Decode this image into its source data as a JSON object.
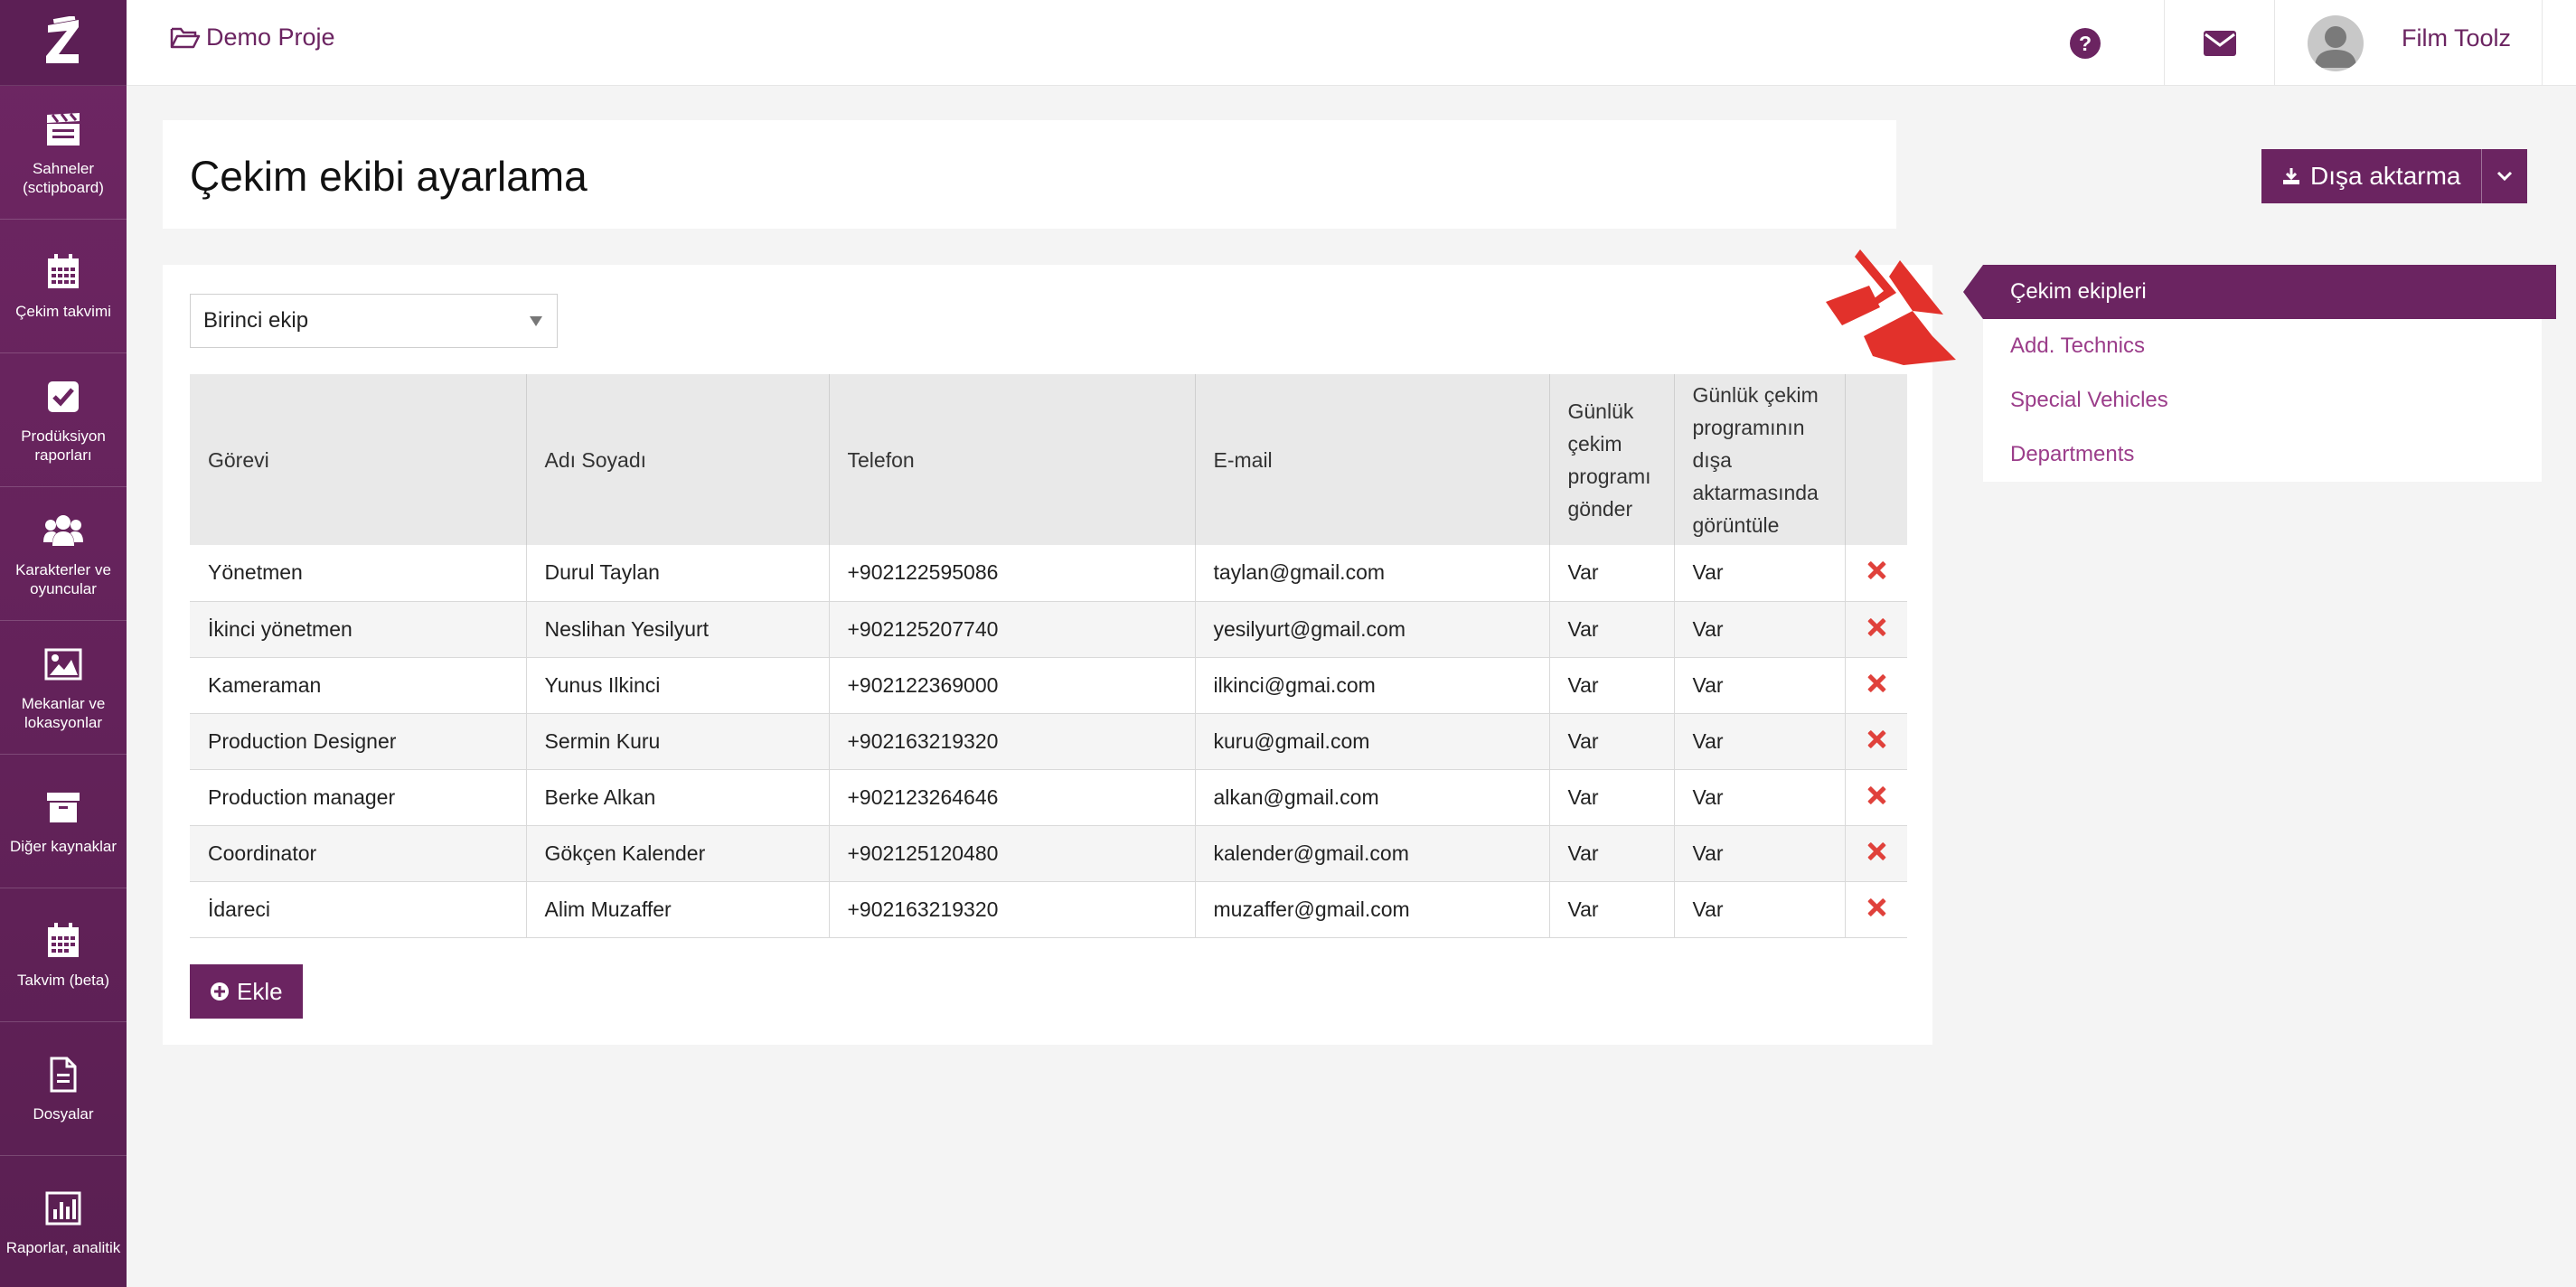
{
  "app": {
    "logo_letter": "Z",
    "language": "TR"
  },
  "sidebar": {
    "items": [
      {
        "label": "Sahneler (sctipboard)",
        "icon": "clapperboard-icon"
      },
      {
        "label": "Çekim takvimi",
        "icon": "calendar-icon"
      },
      {
        "label": "Prodüksiyon raporları",
        "icon": "checkbox-icon"
      },
      {
        "label": "Karakterler ve oyuncular",
        "icon": "users-icon"
      },
      {
        "label": "Mekanlar ve lokasyonlar",
        "icon": "image-icon"
      },
      {
        "label": "Diğer kaynaklar",
        "icon": "archive-icon"
      },
      {
        "label": "Takvim (beta)",
        "icon": "calendar-icon"
      },
      {
        "label": "Dosyalar",
        "icon": "file-icon"
      },
      {
        "label": "Raporlar, analitik",
        "icon": "bar-chart-icon"
      }
    ]
  },
  "topbar": {
    "project": "Demo Proje",
    "user_name": "Film Toolz"
  },
  "page": {
    "title": "Çekim ekibi ayarlama",
    "export_label": "Dışa aktarma",
    "add_label": "Ekle"
  },
  "filter": {
    "selected": "Birinci ekip"
  },
  "table": {
    "headers": [
      "Görevi",
      "Adı Soyadı",
      "Telefon",
      "E-mail",
      "Günlük çekim programı gönder",
      "Günlük çekim programının dışa aktarmasında görüntüle",
      ""
    ],
    "rows": [
      [
        "Yönetmen",
        "Durul Taylan",
        "+902122595086",
        "taylan@gmail.com",
        "Var",
        "Var"
      ],
      [
        "İkinci yönetmen",
        "Neslihan Yesilyurt",
        "+902125207740",
        "yesilyurt@gmail.com",
        "Var",
        "Var"
      ],
      [
        "Kameraman",
        "Yunus Ilkinci",
        "+902122369000",
        "ilkinci@gmai.com",
        "Var",
        "Var"
      ],
      [
        "Production Designer",
        "Sermin Kuru",
        "+902163219320",
        "kuru@gmail.com",
        "Var",
        "Var"
      ],
      [
        "Production manager",
        "Berke Alkan",
        "+902123264646",
        "alkan@gmail.com",
        "Var",
        "Var"
      ],
      [
        "Coordinator",
        "Gökçen Kalender",
        "+902125120480",
        "kalender@gmail.com",
        "Var",
        "Var"
      ],
      [
        "İdareci",
        "Alim Muzaffer",
        "+902163219320",
        "muzaffer@gmail.com",
        "Var",
        "Var"
      ]
    ]
  },
  "right_panel": {
    "items": [
      {
        "label": "Çekim ekipleri",
        "active": true
      },
      {
        "label": "Add. Technics",
        "active": false
      },
      {
        "label": "Special Vehicles",
        "active": false
      },
      {
        "label": "Departments",
        "active": false
      }
    ]
  },
  "colors": {
    "brand": "#6b2461",
    "accent_text": "#9b3d8a",
    "delete": "#e0413b",
    "highlight_arrow": "#e2312b"
  }
}
